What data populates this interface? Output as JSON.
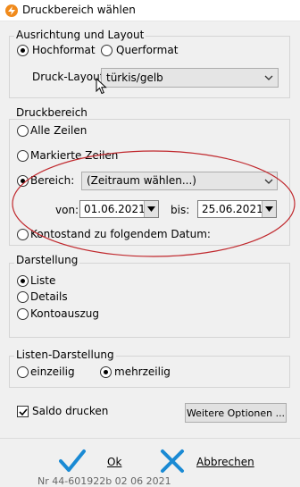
{
  "window": {
    "title": "Druckbereich wählen"
  },
  "orientation": {
    "legend": "Ausrichtung und Layout",
    "portrait_label": "Hochformat",
    "landscape_label": "Querformat",
    "selected": "portrait",
    "layout_label": "Druck-Layout",
    "layout_value": "türkis/gelb"
  },
  "range": {
    "legend": "Druckbereich",
    "all_label": "Alle Zeilen",
    "marked_label": "Markierte Zeilen",
    "area_label": "Bereich:",
    "area_value": "(Zeitraum wählen...)",
    "from_label": "von:",
    "from_value": "01.06.2021",
    "to_label": "bis:",
    "to_value": "25.06.2021",
    "balance_label": "Kontostand zu folgendem Datum:",
    "selected": "area",
    "highlight_color": "#c0282d"
  },
  "display": {
    "legend": "Darstellung",
    "list_label": "Liste",
    "details_label": "Details",
    "statement_label": "Kontoauszug",
    "selected": "list"
  },
  "list_display": {
    "legend": "Listen-Darstellung",
    "single_label": "einzeilig",
    "multi_label": "mehrzeilig",
    "selected": "multi"
  },
  "options": {
    "saldo_label": "Saldo drucken",
    "saldo_checked": true,
    "more_options_label": "Weitere Optionen ..."
  },
  "footer": {
    "ok_label": "Ok",
    "cancel_label": "Abbrechen",
    "ok_color": "#1a8ad4",
    "cancel_color": "#1a8ad4",
    "background_text": "Nr 44-601922b 02 06 2021"
  },
  "icons": [
    "app-logo-icon",
    "chevron-down-icon",
    "checkmark-icon",
    "close-x-icon",
    "mouse-cursor-icon"
  ]
}
